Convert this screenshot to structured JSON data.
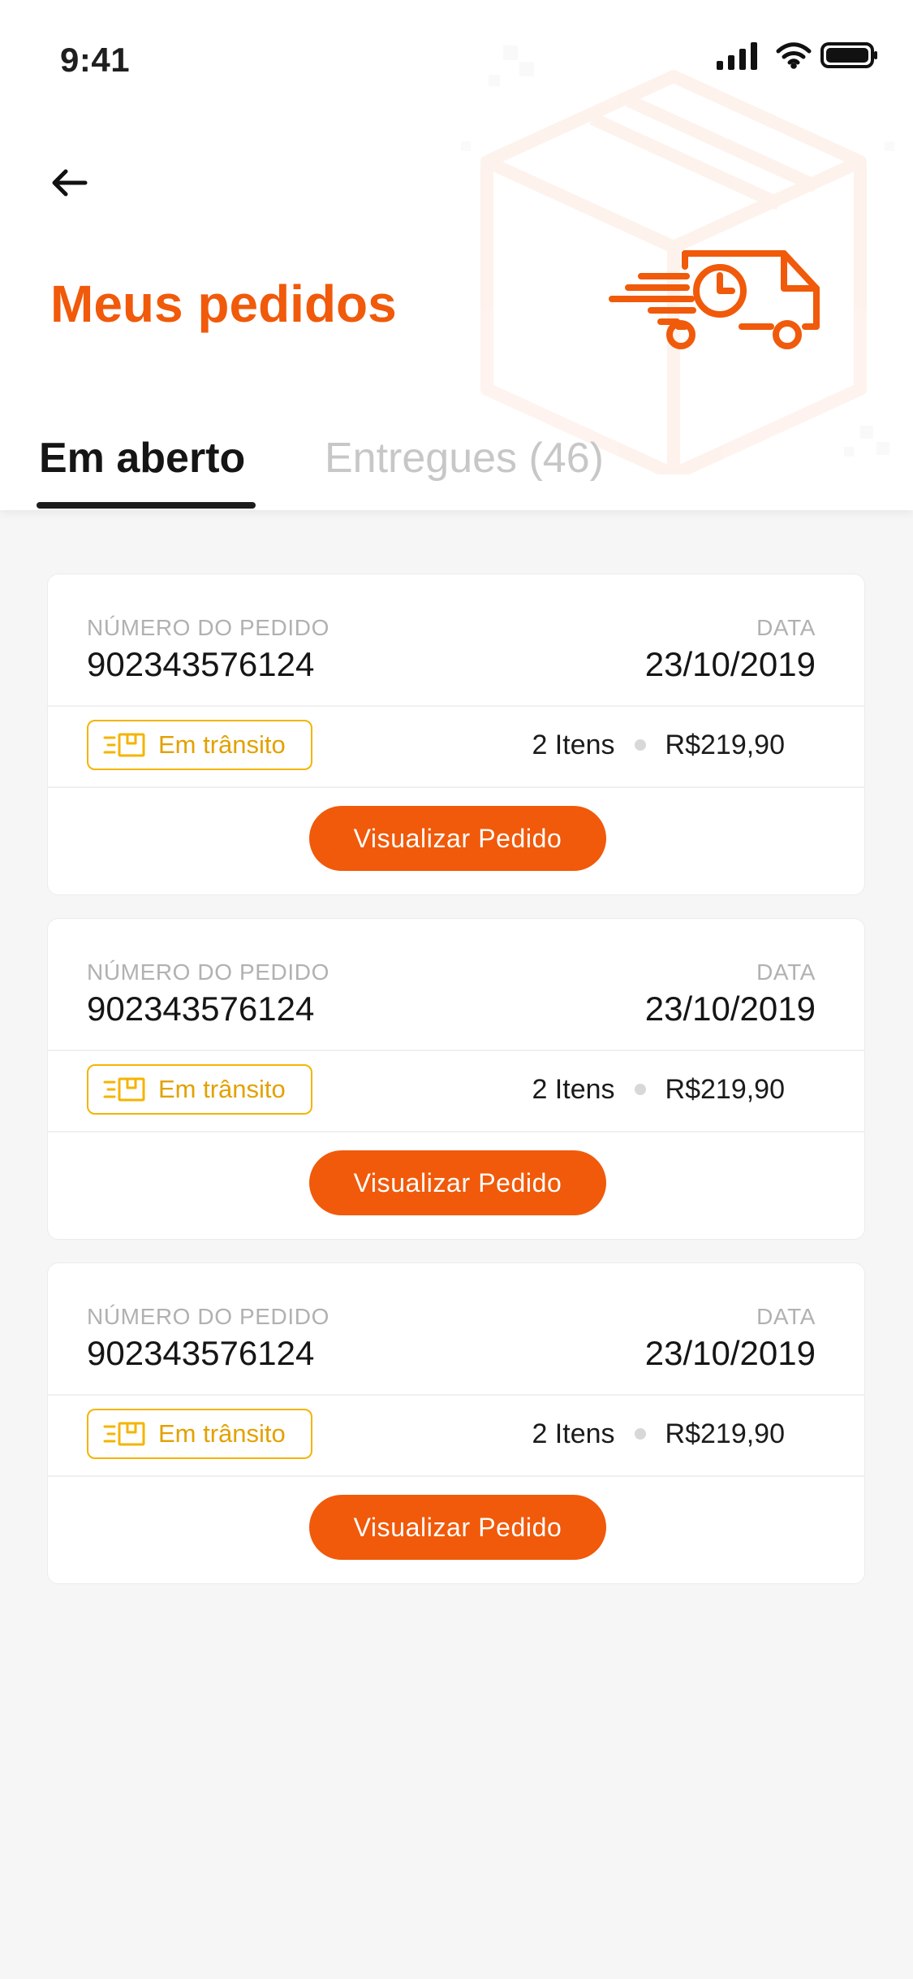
{
  "status_bar": {
    "time": "9:41",
    "icons": [
      "signal-icon",
      "wifi-icon",
      "battery-icon"
    ]
  },
  "header": {
    "back_icon": "back-arrow-icon",
    "title": "Meus pedidos",
    "hero_icon": "delivery-truck-icon"
  },
  "tabs": [
    {
      "label": "Em aberto",
      "active": true
    },
    {
      "label": "Entregues (46)",
      "active": false
    }
  ],
  "orders": [
    {
      "order_number_label": "NÚMERO DO PEDIDO",
      "order_number": "902343576124",
      "date_label": "DATA",
      "date": "23/10/2019",
      "status": "Em trânsito",
      "items": "2 Itens",
      "total": "R$219,90",
      "button_label": "Visualizar Pedido"
    },
    {
      "order_number_label": "NÚMERO DO PEDIDO",
      "order_number": "902343576124",
      "date_label": "DATA",
      "date": "23/10/2019",
      "status": "Em trânsito",
      "items": "2 Itens",
      "total": "R$219,90",
      "button_label": "Visualizar Pedido"
    },
    {
      "order_number_label": "NÚMERO DO PEDIDO",
      "order_number": "902343576124",
      "date_label": "DATA",
      "date": "23/10/2019",
      "status": "Em trânsito",
      "items": "2 Itens",
      "total": "R$219,90",
      "button_label": "Visualizar Pedido"
    }
  ],
  "theme": {
    "accent": "#f05a0a",
    "status": "#e3a100",
    "background": "#f6f6f6"
  }
}
